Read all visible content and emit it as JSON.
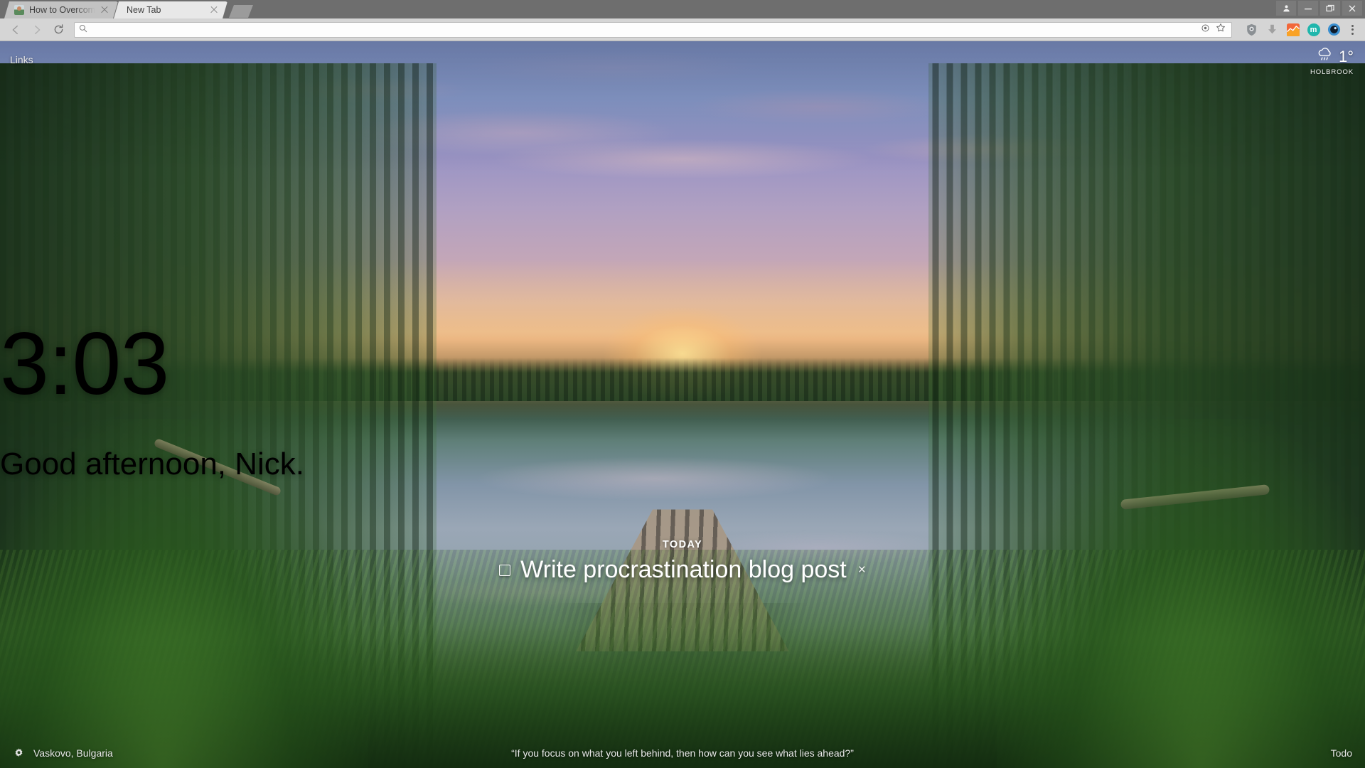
{
  "window": {
    "tabs": [
      {
        "title": "How to Overcome Pro",
        "favicon": "avatar-favicon",
        "active": false
      },
      {
        "title": "New Tab",
        "favicon": "none",
        "active": true
      }
    ],
    "new_tab_button": "new-tab-button",
    "controls": {
      "profile": "profile-avatar-icon",
      "minimize": "minimize-icon",
      "maximize": "maximize-icon",
      "close": "close-icon"
    }
  },
  "toolbar": {
    "back": "back-arrow-icon",
    "forward": "forward-arrow-icon",
    "reload": "reload-icon",
    "omnibox": {
      "value": "",
      "placeholder": "",
      "leading_icon": "search-icon",
      "trailing_icons": [
        "location-target-icon",
        "bookmark-star-icon"
      ]
    },
    "extensions": [
      {
        "name": "privacy-badger-icon",
        "glyph": "☉",
        "color": "#8a8f93"
      },
      {
        "name": "download-arrow-icon",
        "glyph": "↓",
        "color": "#9e9e9e"
      },
      {
        "name": "analytics-chart-icon",
        "glyph": "",
        "color": "#f2673a"
      },
      {
        "name": "momentum-icon",
        "glyph": "m",
        "color": "#1fb6ac"
      },
      {
        "name": "dark-reader-icon",
        "glyph": "",
        "color": "#2b7fc4"
      }
    ],
    "menu": "three-dot-menu-icon"
  },
  "newtab": {
    "links_label": "Links",
    "weather": {
      "icon": "rain-cloud-icon",
      "temperature": "1°",
      "city": "HOLBROOK"
    },
    "clock": "3:03",
    "greeting": "Good afternoon, Nick.",
    "todo": {
      "section_label": "TODAY",
      "items": [
        {
          "text": "Write procrastination blog post",
          "done": false,
          "remove_label": "×"
        }
      ]
    },
    "footer": {
      "settings_icon": "gear-icon",
      "location": "Vaskovo, Bulgaria",
      "quote": "“If you focus on what you left behind, then how can you see what lies ahead?”",
      "todo_link": "Todo"
    }
  }
}
